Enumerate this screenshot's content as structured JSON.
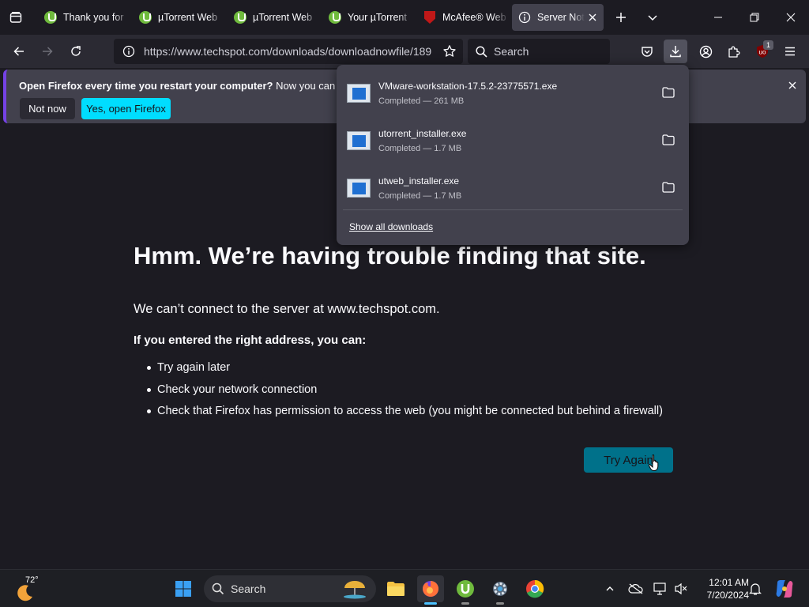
{
  "browser": {
    "tabs": [
      {
        "title": "Thank you for",
        "icon": "utorrent"
      },
      {
        "title": "µTorrent Web",
        "icon": "utorrent"
      },
      {
        "title": "µTorrent Web",
        "icon": "utorrent"
      },
      {
        "title": "Your µTorrent",
        "icon": "utorrent"
      },
      {
        "title": "McAfee® Web",
        "icon": "mcafee"
      },
      {
        "title": "Server Not F",
        "icon": "info",
        "active": true
      }
    ],
    "url": "https://www.techspot.com/downloads/downloadnowfile/189",
    "search_placeholder": "Search",
    "extension_badge": "1"
  },
  "notification": {
    "bold": "Open Firefox every time you restart your computer?",
    "text": " Now you can set Fire",
    "not_now": "Not now",
    "yes": "Yes, open Firefox"
  },
  "downloads": {
    "items": [
      {
        "name": "VMware-workstation-17.5.2-23775571.exe",
        "status": "Completed — 261 MB"
      },
      {
        "name": "utorrent_installer.exe",
        "status": "Completed — 1.7 MB"
      },
      {
        "name": "utweb_installer.exe",
        "status": "Completed — 1.7 MB"
      }
    ],
    "show_all": "Show all downloads"
  },
  "error_page": {
    "title": "Hmm. We’re having trouble finding that site.",
    "description": "We can’t connect to the server at www.techspot.com.",
    "subtitle": "If you entered the right address, you can:",
    "suggestions": [
      "Try again later",
      "Check your network connection",
      "Check that Firefox has permission to access the web (you might be connected but behind a firewall)"
    ],
    "try_again": "Try Again"
  },
  "taskbar": {
    "temperature": "72°",
    "search_label": "Search",
    "time": "12:01 AM",
    "date": "7/20/2024"
  },
  "colors": {
    "accent": "#00ddff",
    "page_bg": "#1c1b22",
    "toolbar_bg": "#2b2a33",
    "panel_bg": "#42414d",
    "try_again_bg": "#00718a"
  }
}
